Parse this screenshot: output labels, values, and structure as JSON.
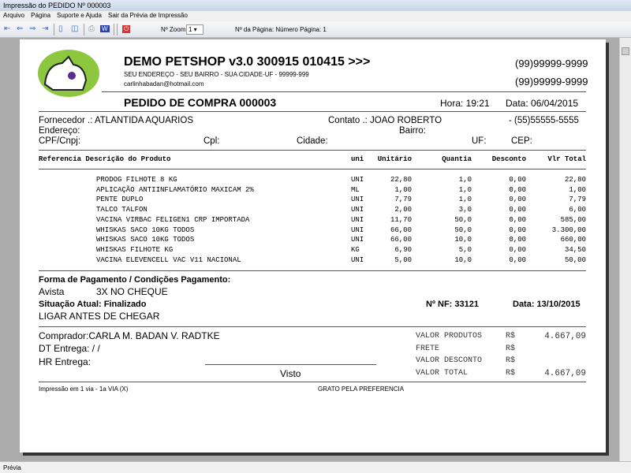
{
  "window": {
    "title": "Impressão do PEDIDO Nº 000003"
  },
  "menu": [
    "Arquivo",
    "Página",
    "Suporte e Ajuda",
    "Sair da Prévia de Impressão"
  ],
  "toolbar": {
    "zoom_label": "Nº Zoom",
    "zoom_value": "1",
    "page_label": "Nº da Página: Número Página: 1"
  },
  "header": {
    "company": "DEMO PETSHOP v3.0 300915 010415 >>>",
    "address": "SEU ENDEREÇO - SEU BAIRRO - SUA CIDADE-UF - 99999-999",
    "email": "carlinhabadan@hotmail.com",
    "phone1": "(99)99999-9999",
    "phone2": "(99)99999-9999",
    "doc_title": "PEDIDO DE COMPRA 000003",
    "hora": "Hora: 19:21",
    "data": "Data: 06/04/2015"
  },
  "supplier": {
    "fornecedor": "Fornecedor .: ATLANTIDA AQUARIOS",
    "contato": "Contato .: JOAO ROBERTO",
    "phone": "- (55)55555-5555",
    "endereco": "Endereço:",
    "bairro": "Bairro:",
    "cpf": "CPF/Cnpj:",
    "cpl": "Cpl:",
    "cidade": "Cidade:",
    "uf": "UF:",
    "cep": "CEP:"
  },
  "table": {
    "headers": [
      "Referencia Descrição do Produto",
      "uni",
      "Unitário",
      "Quantia",
      "Desconto",
      "Vlr Total"
    ],
    "rows": [
      [
        "PRODOG FILHOTE 8 KG",
        "UNI",
        "22,80",
        "1,0",
        "0,00",
        "22,80"
      ],
      [
        "APLICAÇÃO ANTIINFLAMATÓRIO MAXICAM 2%",
        "ML",
        "1,00",
        "1,0",
        "0,00",
        "1,00"
      ],
      [
        "PENTE DUPLO",
        "UNI",
        "7,79",
        "1,0",
        "0,00",
        "7,79"
      ],
      [
        "TALCO TALFON",
        "UNI",
        "2,00",
        "3,0",
        "0,00",
        "6,00"
      ],
      [
        "VACINA VIRBAC FELIGEN1 CRP IMPORTADA",
        "UNI",
        "11,70",
        "50,0",
        "0,00",
        "585,00"
      ],
      [
        "WHISKAS SACO 10KG TODOS",
        "UNI",
        "66,00",
        "50,0",
        "0,00",
        "3.300,00"
      ],
      [
        "WHISKAS SACO 10KG TODOS",
        "UNI",
        "66,00",
        "10,0",
        "0,00",
        "660,00"
      ],
      [
        "WHISKAS FILHOTE KG",
        "KG",
        "6,90",
        "5,0",
        "0,00",
        "34,50"
      ],
      [
        "VACINA ELEVENCELL VAC V11 NACIONAL",
        "UNI",
        "5,00",
        "10,0",
        "0,00",
        "50,00"
      ]
    ]
  },
  "payment": {
    "title": "Forma de Pagamento / Condições Pagamento:",
    "type": "Avista",
    "cond": "3X NO CHEQUE",
    "situacao": "Situação Atual: Finalizado",
    "nf": "Nº NF:  33121",
    "data": "Data: 13/10/2015",
    "obs": "LIGAR ANTES DE CHEGAR"
  },
  "footer": {
    "comprador": "Comprador:CARLA M. BADAN V. RADTKE",
    "dt": "DT Entrega:  / /",
    "hr": "HR Entrega:",
    "visto": "Visto",
    "totals": [
      [
        "VALOR PRODUTOS",
        "R$",
        "4.667,09"
      ],
      [
        "FRETE",
        "R$",
        ""
      ],
      [
        "VALOR DESCONTO",
        "R$",
        ""
      ],
      [
        "VALOR TOTAL",
        "R$",
        "4.667,09"
      ]
    ],
    "impressao": "Impressão em 1 via  -  1a VIA (X)",
    "grato": "GRATO PELA PREFERENCIA"
  },
  "status": "Prévia"
}
